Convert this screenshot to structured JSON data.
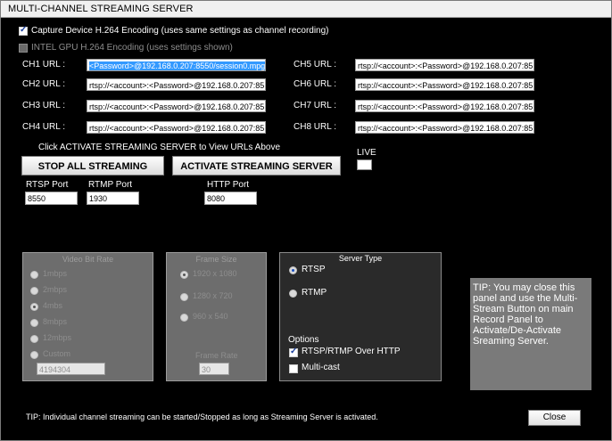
{
  "window": {
    "title": "MULTI-CHANNEL STREAMING SERVER"
  },
  "options": {
    "capture_h264": {
      "label": "Capture Device H.264 Encoding (uses same settings as channel recording)",
      "checked": true
    },
    "intel_gpu": {
      "label": "INTEL GPU H.264 Encoding (uses settings shown)",
      "checked": false,
      "disabled": true
    }
  },
  "channels_left": [
    {
      "label": "CH1 URL :",
      "value": "<Password>@192.168.0.207:8550/session0.mpg",
      "selected": true
    },
    {
      "label": "CH2 URL :",
      "value": "rtsp://<account>:<Password>@192.168.0.207:85"
    },
    {
      "label": "CH3 URL :",
      "value": "rtsp://<account>:<Password>@192.168.0.207:85"
    },
    {
      "label": "CH4 URL :",
      "value": "rtsp://<account>:<Password>@192.168.0.207:85"
    }
  ],
  "channels_right": [
    {
      "label": "CH5 URL :",
      "value": "rtsp://<account>:<Password>@192.168.0.207:85"
    },
    {
      "label": "CH6 URL :",
      "value": "rtsp://<account>:<Password>@192.168.0.207:85"
    },
    {
      "label": "CH7 URL :",
      "value": "rtsp://<account>:<Password>@192.168.0.207:85"
    },
    {
      "label": "CH8 URL :",
      "value": "rtsp://<account>:<Password>@192.168.0.207:85"
    }
  ],
  "hint": "Click ACTIVATE STREAMING SERVER to View URLs Above",
  "buttons": {
    "stop_all": "STOP ALL STREAMING",
    "activate": "ACTIVATE STREAMING SERVER",
    "close": "Close"
  },
  "live": {
    "label": "LIVE"
  },
  "ports": {
    "rtsp": {
      "label": "RTSP Port",
      "value": "8550"
    },
    "rtmp": {
      "label": "RTMP Port",
      "value": "1930"
    },
    "http": {
      "label": "HTTP Port",
      "value": "8080"
    }
  },
  "video_bit_rate": {
    "title": "Video Bit Rate",
    "options": [
      "1mbps",
      "2mbps",
      "4mbs",
      "8mbps",
      "12mbps",
      "Custom"
    ],
    "selected": "4mbs",
    "custom_value": "4194304"
  },
  "frame_size": {
    "title": "Frame Size",
    "options": [
      "1920 x 1080",
      "1280 x 720",
      "960 x 540"
    ],
    "selected": "1920 x 1080",
    "frame_rate_label": "Frame Rate",
    "frame_rate_value": "30"
  },
  "server_type": {
    "title": "Server Type",
    "options": [
      "RTSP",
      "RTMP"
    ],
    "selected": "RTSP",
    "options_label": "Options",
    "over_http": {
      "label": "RTSP/RTMP Over HTTP",
      "checked": true
    },
    "multicast": {
      "label": "Multi-cast",
      "checked": false
    }
  },
  "tip_box": "TIP: You may close this panel and use the Multi-Stream Button on main Record Panel to Activate/De-Activate Sreaming Server.",
  "footer_tip": "TIP: Individual channel streaming can be started/Stopped as long as Streaming Server is activated.",
  "colors": {
    "panel_bg": "#000000",
    "group_bg": "#6d6d6d",
    "selection": "#3399ff",
    "tip_bg": "#7a7a7a"
  }
}
